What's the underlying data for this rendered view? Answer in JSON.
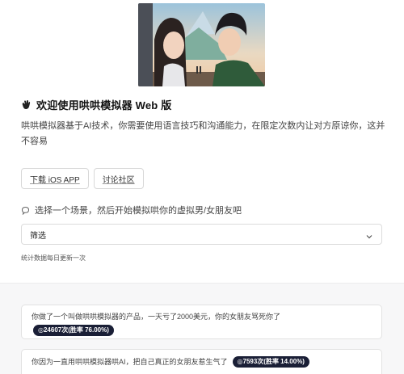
{
  "header": {
    "title": "欢迎使用哄哄模拟器 Web 版",
    "description": "哄哄模拟器基于AI技术，你需要使用语言技巧和沟通能力，在限定次数内让对方原谅你，这并不容易"
  },
  "actions": {
    "download_ios": "下载 iOS APP",
    "community": "讨论社区"
  },
  "scenario": {
    "prompt": "选择一个场景，然后开始模拟哄你的虚拟男/女朋友吧",
    "filter_value": "筛选",
    "update_note": "统计数据每日更新一次"
  },
  "scenarios": [
    {
      "text": "你做了一个叫做哄哄模拟器的产品，一天亏了2000美元，你的女朋友骂死你了",
      "stats": "◎24607次(胜率 76.00%)"
    },
    {
      "text": "你因为一直用哄哄模拟器哄AI，把自己真正的女朋友惹生气了",
      "stats": "◎7593次(胜率 14.00%)"
    }
  ],
  "icons": {
    "title": "hand-wave-icon",
    "hint": "chat-bubble-icon",
    "select": "chevron-down-icon"
  }
}
